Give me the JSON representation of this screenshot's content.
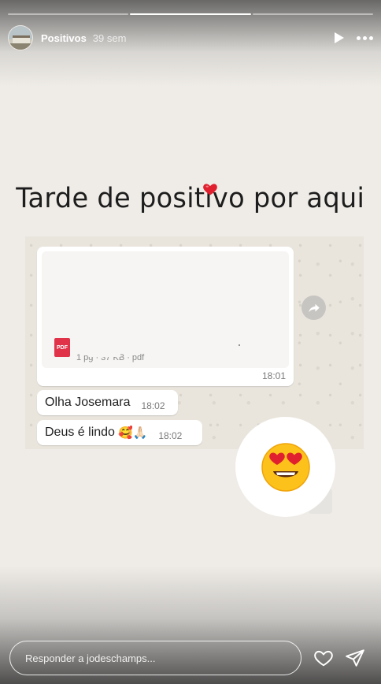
{
  "story": {
    "progress_segments": 3,
    "progress_done": 1,
    "username": "Positivos",
    "time_ago": "39 sem",
    "headline": "Tarde de positivo por aqui"
  },
  "chat": {
    "document": {
      "icon_label": "PDF",
      "meta": "1 pg · 37 KB · pdf",
      "time": "18:01"
    },
    "messages": [
      {
        "text": "Olha Josemara",
        "time": "18:02"
      },
      {
        "text": "Deus é lindo",
        "time": "18:02",
        "emojis": "🥰🙏🏻"
      }
    ],
    "sticker_emoji": "😍"
  },
  "footer": {
    "reply_placeholder": "Responder a jodeschamps..."
  },
  "colors": {
    "heart_red": "#e0202e",
    "pdf_red": "#e0334a",
    "bubble": "#ffffff"
  },
  "icons": [
    "avatar",
    "play-icon",
    "more-icon",
    "heart-icon",
    "pdf-icon",
    "share-icon",
    "like-icon",
    "send-icon"
  ]
}
